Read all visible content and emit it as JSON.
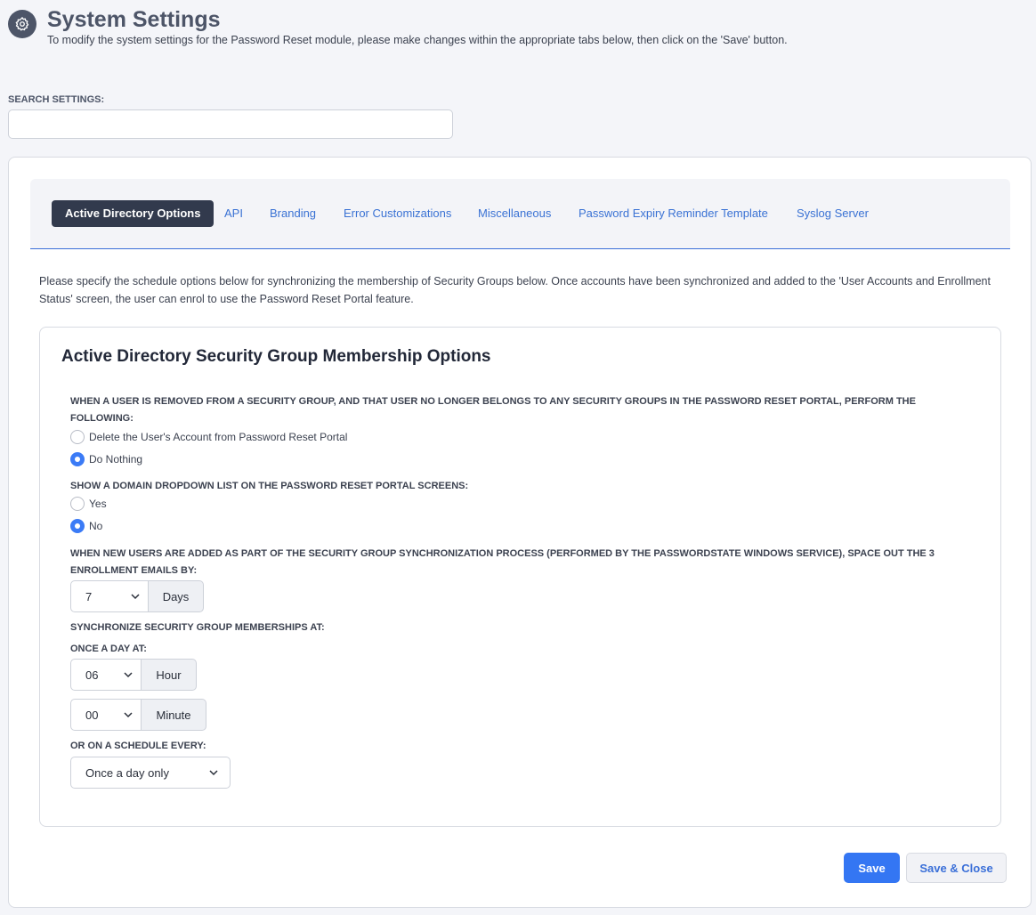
{
  "header": {
    "icon": "gear-icon",
    "title": "System Settings",
    "subtitle": "To modify the system settings for the Password Reset module, please make changes within the appropriate tabs below, then click on the 'Save' button."
  },
  "search": {
    "label": "SEARCH SETTINGS:",
    "value": ""
  },
  "tabs": [
    {
      "label": "Active Directory Options",
      "active": true
    },
    {
      "label": "API"
    },
    {
      "label": "Branding"
    },
    {
      "label": "Error Customizations"
    },
    {
      "label": "Miscellaneous"
    },
    {
      "label": "Password Expiry Reminder Template"
    },
    {
      "label": "Syslog Server"
    }
  ],
  "intro": "Please specify the schedule options below for synchronizing the membership of Security Groups below. Once accounts have been synchronized and added to the 'User Accounts and Enrollment Status' screen, the user can enrol to use the Password Reset Portal feature.",
  "section": {
    "title": "Active Directory Security Group Membership Options",
    "removed_user": {
      "label": "WHEN A USER IS REMOVED FROM A SECURITY GROUP, AND THAT USER NO LONGER BELONGS TO ANY SECURITY GROUPS IN THE PASSWORD RESET PORTAL, PERFORM THE FOLLOWING:",
      "options": [
        "Delete the User's Account from Password Reset Portal",
        "Do Nothing"
      ],
      "selected": "Do Nothing"
    },
    "domain_dropdown": {
      "label": "SHOW A DOMAIN DROPDOWN LIST ON THE PASSWORD RESET PORTAL SCREENS:",
      "options": [
        "Yes",
        "No"
      ],
      "selected": "No"
    },
    "enrollment_emails": {
      "label": "WHEN NEW USERS ARE ADDED AS PART OF THE SECURITY GROUP SYNCHRONIZATION PROCESS (PERFORMED BY THE PASSWORDSTATE WINDOWS SERVICE), SPACE OUT THE 3 ENROLLMENT EMAILS BY:",
      "value": "7",
      "unit": "Days"
    },
    "sync": {
      "label": "SYNCHRONIZE SECURITY GROUP MEMBERSHIPS AT:",
      "once_label": "ONCE A DAY AT:",
      "hour_value": "06",
      "hour_unit": "Hour",
      "minute_value": "00",
      "minute_unit": "Minute",
      "schedule_label": "OR ON A SCHEDULE EVERY:",
      "schedule_value": "Once a day only"
    }
  },
  "buttons": {
    "save": "Save",
    "save_close": "Save & Close"
  },
  "colors": {
    "accent": "#3476f3",
    "active_tab": "#323a4d",
    "link": "#3a72d4"
  }
}
